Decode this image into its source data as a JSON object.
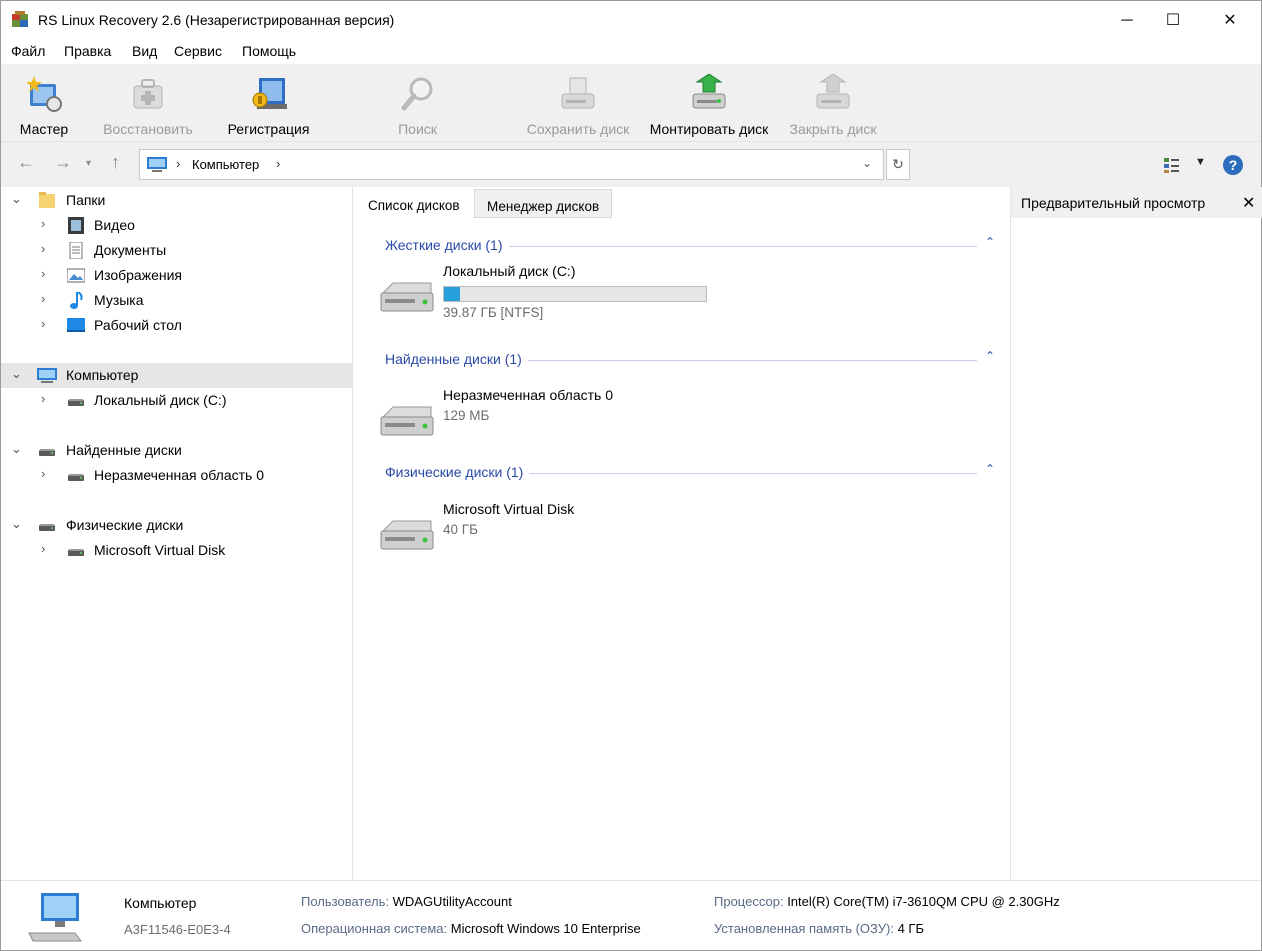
{
  "window": {
    "title": "RS Linux Recovery 2.6 (Незарегистрированная версия)",
    "minimize": "─",
    "maximize": "☐",
    "close": "✕"
  },
  "menu": [
    "Файл",
    "Правка",
    "Вид",
    "Сервис",
    "Помощь"
  ],
  "toolbar": {
    "master": "Мастер",
    "restore": "Восстановить",
    "register": "Регистрация",
    "search": "Поиск",
    "save_disk": "Сохранить диск",
    "mount_disk": "Монтировать диск",
    "close_disk": "Закрыть диск"
  },
  "address": {
    "crumb": "Компьютер",
    "sep": "›"
  },
  "tree": {
    "folders": "Папки",
    "video": "Видео",
    "documents": "Документы",
    "images": "Изображения",
    "music": "Музыка",
    "desktop": "Рабочий стол",
    "computer": "Компьютер",
    "local_disk": "Локальный диск (C:)",
    "found_disks": "Найденные диски",
    "unallocated": "Неразмеченная область 0",
    "physical_disks": "Физические диски",
    "virtual_disk": "Microsoft Virtual Disk"
  },
  "tabs": {
    "disk_list": "Список дисков",
    "disk_manager": "Менеджер дисков"
  },
  "groups": {
    "hard": "Жесткие диски (1)",
    "found": "Найденные диски (1)",
    "physical": "Физические диски (1)"
  },
  "disks": {
    "local_name": "Локальный диск (C:)",
    "local_size": "39.87 ГБ [NTFS]",
    "local_used_fraction": 0.06,
    "unalloc_name": "Неразмеченная область 0",
    "unalloc_size": "129 МБ",
    "vdisk_name": "Microsoft Virtual Disk",
    "vdisk_size": "40 ГБ"
  },
  "preview": {
    "title": "Предварительный просмотр",
    "close": "✕"
  },
  "status": {
    "name": "Компьютер",
    "id": "A3F11546-E0E3-4",
    "user_key": "Пользователь:",
    "user_val": "WDAGUtilityAccount",
    "os_key": "Операционная система:",
    "os_val": "Microsoft Windows 10 Enterprise",
    "cpu_key": "Процессор:",
    "cpu_val": "Intel(R) Core(TM) i7-3610QM CPU @ 2.30GHz",
    "ram_key": "Установленная память (ОЗУ):",
    "ram_val": "4 ГБ"
  },
  "colors": {
    "accent": "#26a0da",
    "group_text": "#2a4aa8",
    "selection": "#e6e6e6",
    "toolbar_bg": "#f0f0f0"
  }
}
